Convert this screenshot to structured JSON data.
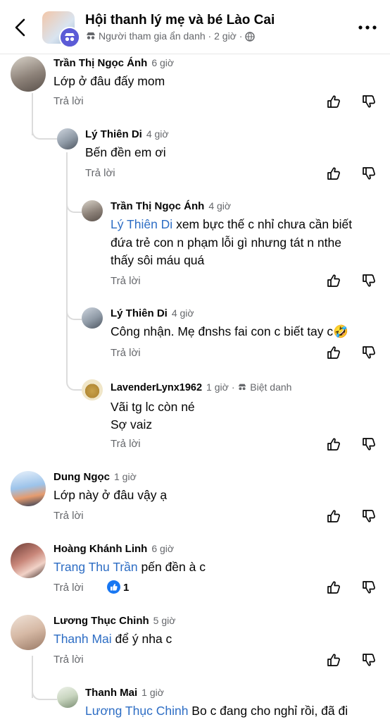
{
  "header": {
    "title": "Hội thanh lý mẹ và bé Lào Cai",
    "subtitle": "Người tham gia ẩn danh",
    "time": "2 giờ"
  },
  "reply_label": "Trả lời",
  "comments": [
    {
      "name": "Trần Thị Ngọc Ánh",
      "time": "6 giờ",
      "text": "Lớp ở đâu đấy mom"
    },
    {
      "name": "Lý Thiên Di",
      "time": "4 giờ",
      "text": "Bến đền em ơi"
    },
    {
      "name": "Trần Thị Ngọc Ánh",
      "time": "4 giờ",
      "mention": "Lý Thiên Di",
      "text1": " xem bực thế c nhỉ chưa cần biết",
      "text2": "đứa trẻ con n phạm lỗi gì nhưng tát n nthe",
      "text3": "thấy sôi máu quá"
    },
    {
      "name": "Lý Thiên Di",
      "time": "4 giờ",
      "text": "Công nhận. Mẹ đnshs fai con c biết tay c🤣"
    },
    {
      "name": "LavenderLynx1962",
      "time": "1 giờ",
      "badge": "Biệt danh",
      "text1": "Vãi tg lc còn né",
      "text2": "Sợ vaiz"
    },
    {
      "name": "Dung Ngọc",
      "time": "1 giờ",
      "text": "Lớp này ở đâu vậy ạ"
    },
    {
      "name": "Hoàng Khánh Linh",
      "time": "6 giờ",
      "mention": "Trang Thu Trần",
      "text": " pến đền à c",
      "reaction_count": "1"
    },
    {
      "name": "Lương Thục Chinh",
      "time": "5 giờ",
      "mention": "Thanh Mai",
      "text": " để ý nha c"
    },
    {
      "name": "Thanh Mai",
      "time": "1 giờ",
      "mention": "Lương Thục Chinh",
      "text": " Bo c đang cho nghỉ rồi, đã đi"
    }
  ],
  "colors": {
    "mention": "#2d6dc4",
    "secondary": "#65676b",
    "reaction": "#1877f2"
  }
}
